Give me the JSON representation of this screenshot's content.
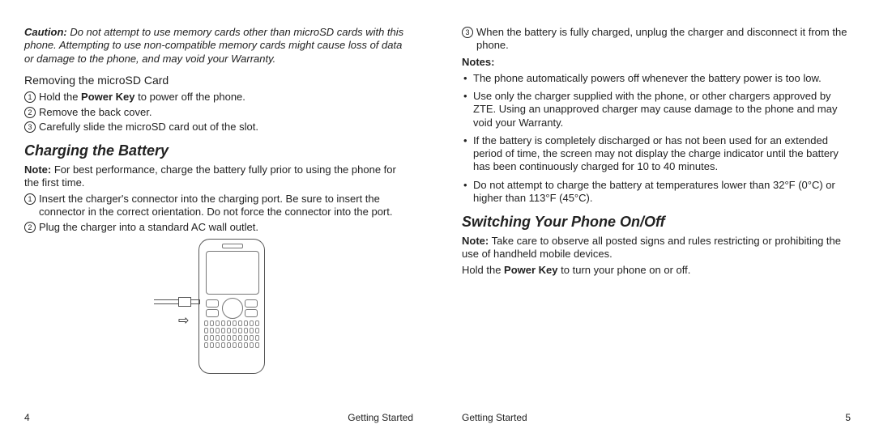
{
  "left": {
    "caution_bold": "Caution:",
    "caution_text": " Do not attempt to use memory cards other than microSD cards with this phone. Attempting to use non-compatible memory cards might cause loss of data or damage to the phone, and may void your Warranty.",
    "remove_head": "Removing the microSD Card",
    "remove_steps": [
      "Hold the ",
      " to power off the phone.",
      "Remove the back cover.",
      "Carefully slide the microSD card out of the slot."
    ],
    "power_key": "Power Key",
    "charging_head": "Charging the Battery",
    "note_bold": "Note:",
    "note_text": " For best performance, charge the battery fully prior to using the phone for the first time.",
    "charge_steps": [
      "Insert the charger's connector into the charging port. Be sure to insert the connector in the correct orientation. Do not force the connector into the port.",
      "Plug the charger into a standard AC wall outlet."
    ],
    "page_num": "4",
    "section": "Getting Started"
  },
  "right": {
    "step3": "When the battery is fully charged, unplug the charger and disconnect it from the phone.",
    "notes_head": "Notes:",
    "notes": [
      "The phone automatically powers off whenever the battery power is too low.",
      "Use only the charger supplied with the phone, or other chargers approved by ZTE. Using an unapproved charger may cause damage to the phone and may void your Warranty.",
      "If the battery is completely discharged or has not been used for an extended period of time, the screen may not display the charge indicator until the battery has been continuously charged for 10 to 40 minutes.",
      "Do not attempt to charge the battery at temperatures lower than 32°F (0°C) or higher than 113°F (45°C)."
    ],
    "switch_head": "Switching Your Phone On/Off",
    "note_bold": "Note:",
    "switch_note": " Take care to observe all posted signs and rules restricting or prohibiting the use of handheld mobile devices.",
    "hold_pre": "Hold the ",
    "power_key": "Power Key",
    "hold_post": " to turn your phone on or off.",
    "section": "Getting Started",
    "page_num": "5"
  }
}
